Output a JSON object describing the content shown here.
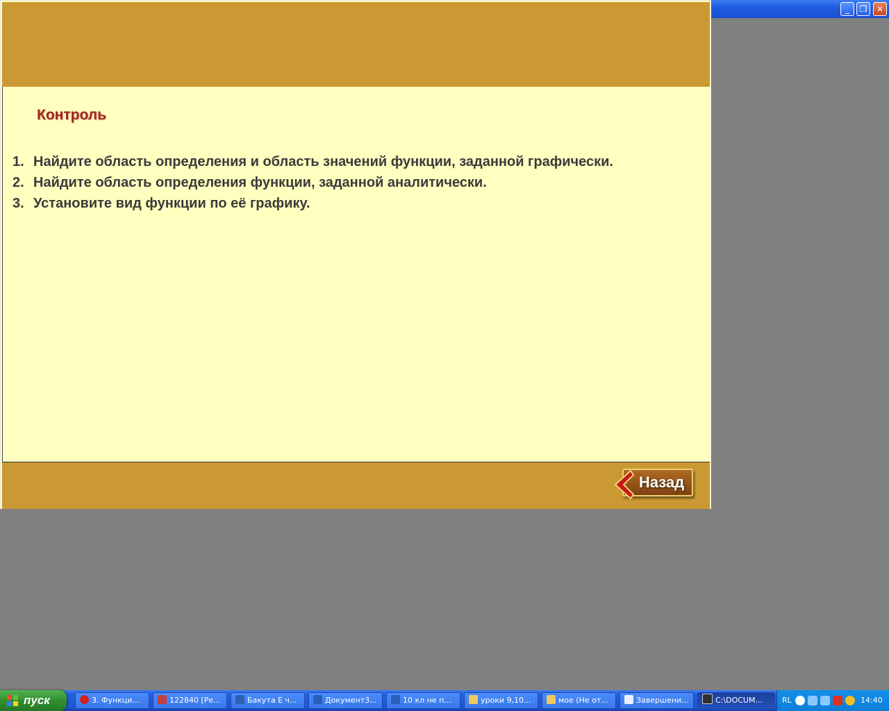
{
  "background_window": {
    "buttons": {
      "minimize": "_",
      "restore": "❐",
      "close": "✕"
    }
  },
  "slide": {
    "heading": "Контроль",
    "tasks": [
      {
        "num": "1.",
        "text": "Найдите область определения и область значений функции, заданной графически."
      },
      {
        "num": "2.",
        "text": "Найдите область определения функции, заданной аналитически."
      },
      {
        "num": "3.",
        "text": "Установите вид функции по её графику."
      }
    ],
    "back_label": "Назад"
  },
  "taskbar": {
    "start_label": "пуск",
    "items": [
      {
        "label": "3. Функци...",
        "icon": "opera-icon",
        "color": "#d02020"
      },
      {
        "label": "122840 [Ре...",
        "icon": "pdf-icon",
        "color": "#c04040"
      },
      {
        "label": "Бакута Е ч...",
        "icon": "word-icon",
        "color": "#2c5fb8"
      },
      {
        "label": "Документ3...",
        "icon": "word-icon",
        "color": "#2c5fb8"
      },
      {
        "label": "10 кл  не п...",
        "icon": "word-icon",
        "color": "#2c5fb8"
      },
      {
        "label": "уроки 9,10...",
        "icon": "folder-icon",
        "color": "#f0c860"
      },
      {
        "label": "мое (Не от...",
        "icon": "folder-icon",
        "color": "#f0c860"
      },
      {
        "label": "Завершени...",
        "icon": "window-icon",
        "color": "#e8f0ff"
      },
      {
        "label": "C:\\DOCUM...",
        "icon": "app-icon",
        "color": "#303030"
      }
    ],
    "tray": {
      "lang": "RL",
      "clock": "14:40"
    }
  }
}
